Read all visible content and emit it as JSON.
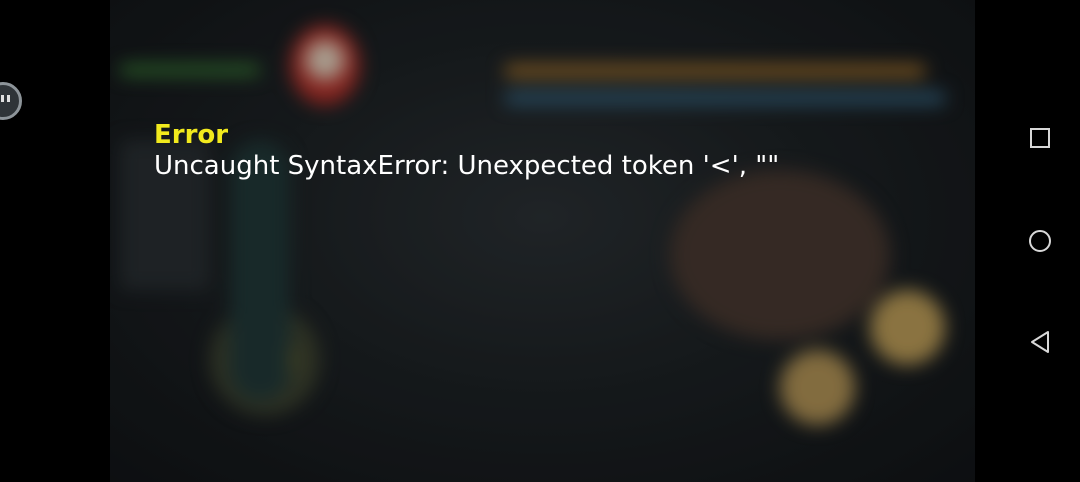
{
  "error": {
    "title": "Error",
    "message": "Uncaught SyntaxError: Unexpected token '<', \"\""
  },
  "nav_bar": {
    "recents": "recents-square-icon",
    "home": "home-circle-icon",
    "back": "back-triangle-icon"
  },
  "colors": {
    "error_title": "#f2ea1d",
    "error_message": "#ffffff",
    "nav_icon": "#d8d8d8",
    "background": "#000000"
  }
}
